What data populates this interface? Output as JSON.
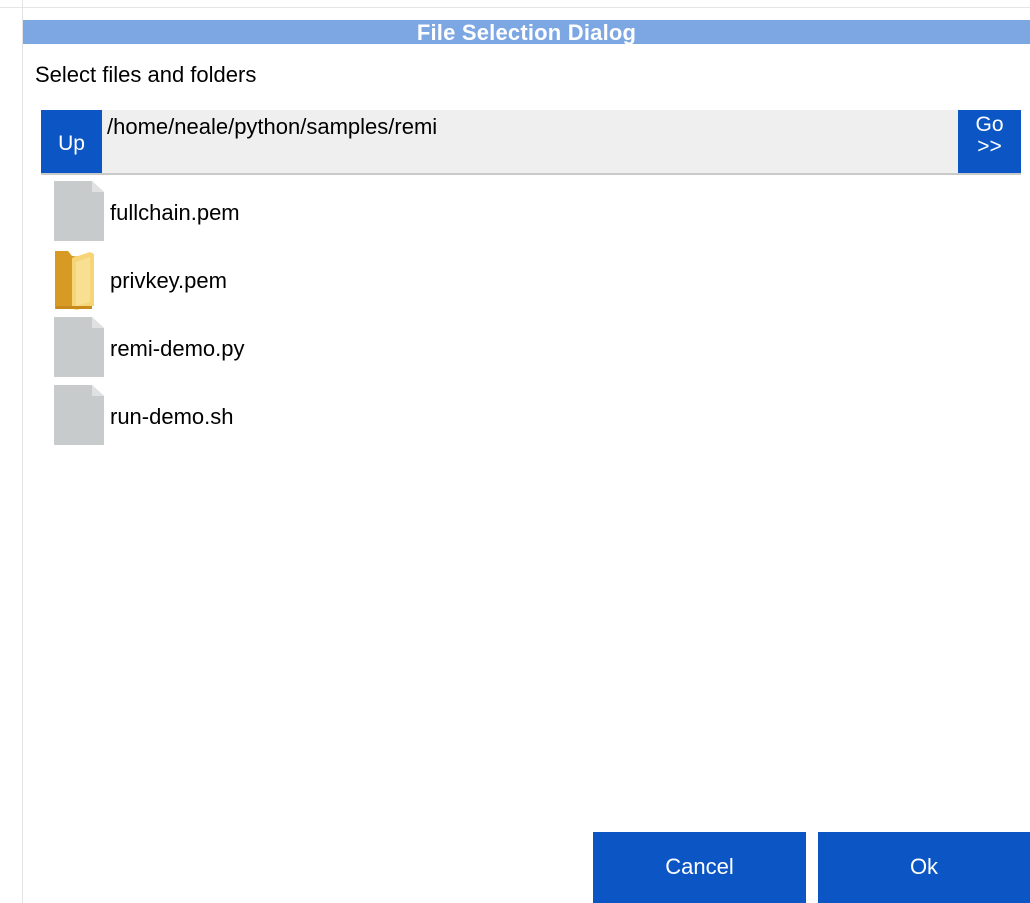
{
  "dialog": {
    "title": "File Selection Dialog",
    "subtitle": "Select files and folders"
  },
  "pathbar": {
    "up_label": "Up",
    "path": "/home/neale/python/samples/remi",
    "go_label_line1": "Go",
    "go_label_line2": ">>"
  },
  "files": [
    {
      "name": "fullchain.pem",
      "icon": "file-icon"
    },
    {
      "name": "privkey.pem",
      "icon": "folder-icon"
    },
    {
      "name": "remi-demo.py",
      "icon": "file-icon"
    },
    {
      "name": "run-demo.sh",
      "icon": "file-icon"
    }
  ],
  "buttons": {
    "cancel_label": "Cancel",
    "ok_label": "Ok"
  },
  "colors": {
    "titlebar": "#7da7e3",
    "button": "#0b56c4",
    "pathbar_bg": "#efefef",
    "file_icon": "#c8cbcc",
    "folder_icon": "#f1c254"
  }
}
